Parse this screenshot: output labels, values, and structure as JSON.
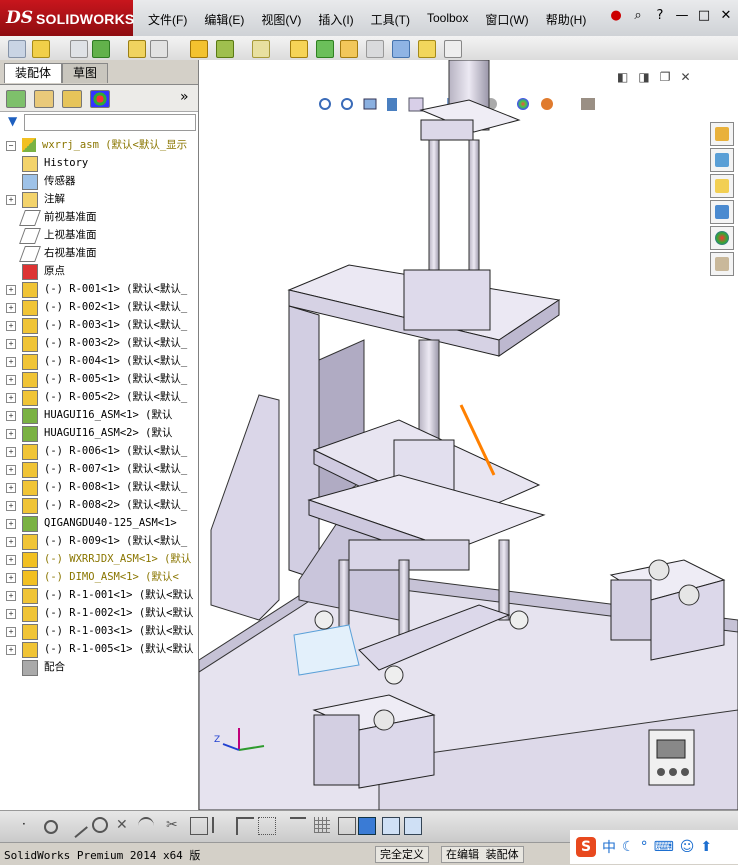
{
  "app": {
    "brand_ds": "DS",
    "brand_name": "SOLIDWORKS"
  },
  "menu": [
    "文件(F)",
    "编辑(E)",
    "视图(V)",
    "插入(I)",
    "工具(T)",
    "Toolbox",
    "窗口(W)",
    "帮助(H)"
  ],
  "window_controls": {
    "minimize": "—",
    "restore": "□",
    "close": "✕"
  },
  "tabs": {
    "assembly": "装配体",
    "sketch": "草图"
  },
  "tree": {
    "root": "wxrrj_asm  (默认<默认_显示",
    "items": [
      {
        "label": "History",
        "icon": "history-icon",
        "expand": ""
      },
      {
        "label": "传感器",
        "icon": "sensor-icon",
        "expand": ""
      },
      {
        "label": "注解",
        "icon": "annotation-icon",
        "expand": "+"
      },
      {
        "label": "前视基准面",
        "icon": "plane-icon",
        "expand": ""
      },
      {
        "label": "上视基准面",
        "icon": "plane-icon",
        "expand": ""
      },
      {
        "label": "右视基准面",
        "icon": "plane-icon",
        "expand": ""
      },
      {
        "label": "原点",
        "icon": "origin-icon",
        "expand": ""
      },
      {
        "label": "(-) R-001<1> (默认<默认_",
        "icon": "part-icon",
        "expand": "+"
      },
      {
        "label": "(-) R-002<1> (默认<默认_",
        "icon": "part-icon",
        "expand": "+"
      },
      {
        "label": "(-) R-003<1> (默认<默认_",
        "icon": "part-icon",
        "expand": "+"
      },
      {
        "label": "(-) R-003<2> (默认<默认_",
        "icon": "part-icon",
        "expand": "+"
      },
      {
        "label": "(-) R-004<1> (默认<默认_",
        "icon": "part-icon",
        "expand": "+"
      },
      {
        "label": "(-) R-005<1> (默认<默认_",
        "icon": "part-icon",
        "expand": "+"
      },
      {
        "label": "(-) R-005<2> (默认<默认_",
        "icon": "part-icon",
        "expand": "+"
      },
      {
        "label": "HUAGUI16_ASM<1> (默认",
        "icon": "subassembly-icon",
        "expand": "+"
      },
      {
        "label": "HUAGUI16_ASM<2> (默认",
        "icon": "subassembly-icon",
        "expand": "+"
      },
      {
        "label": "(-) R-006<1> (默认<默认_",
        "icon": "part-icon",
        "expand": "+"
      },
      {
        "label": "(-) R-007<1> (默认<默认_",
        "icon": "part-icon",
        "expand": "+"
      },
      {
        "label": "(-) R-008<1> (默认<默认_",
        "icon": "part-icon",
        "expand": "+"
      },
      {
        "label": "(-) R-008<2> (默认<默认_",
        "icon": "part-icon",
        "expand": "+"
      },
      {
        "label": "QIGANGDU40-125_ASM<1>",
        "icon": "subassembly-icon",
        "expand": "+"
      },
      {
        "label": "(-) R-009<1> (默认<默认_",
        "icon": "part-icon",
        "expand": "+"
      },
      {
        "label": "(-) WXRRJDX_ASM<1> (默认",
        "icon": "warning-subassembly-icon",
        "expand": "+",
        "warn": true
      },
      {
        "label": "(-) DIMO_ASM<1> (默认<",
        "icon": "warning-subassembly-icon",
        "expand": "+",
        "warn": true
      },
      {
        "label": "(-) R-1-001<1> (默认<默认",
        "icon": "part-icon",
        "expand": "+"
      },
      {
        "label": "(-) R-1-002<1> (默认<默认",
        "icon": "part-icon",
        "expand": "+"
      },
      {
        "label": "(-) R-1-003<1> (默认<默认",
        "icon": "part-icon",
        "expand": "+"
      },
      {
        "label": "(-) R-1-005<1> (默认<默认",
        "icon": "part-icon",
        "expand": "+"
      },
      {
        "label": "配合",
        "icon": "mates-icon",
        "expand": ""
      }
    ]
  },
  "status": {
    "product": "SolidWorks Premium 2014 x64 版",
    "definition": "完全定义",
    "editing": "在编辑 装配体"
  },
  "ime": {
    "lang": "中"
  },
  "colors": {
    "accent": "#c8161d",
    "part_fill": "#dad6e8",
    "highlight": "#ff8000"
  }
}
